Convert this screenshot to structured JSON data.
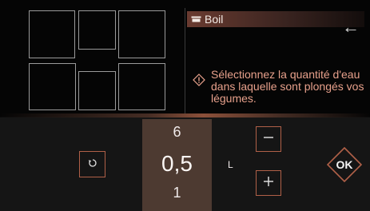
{
  "header": {
    "mode_label": "Boil",
    "mode_icon": "pot-icon"
  },
  "info": {
    "icon": "info-diamond-icon",
    "text": "Sélectionnez la quantité d'eau dans laquelle sont plongés vos légumes."
  },
  "picker": {
    "prev_value": "6",
    "current_value": "0,5",
    "next_value": "1",
    "unit": "L"
  },
  "actions": {
    "ok_label": "OK"
  },
  "colors": {
    "accent": "#b06048",
    "info_text": "#e7a08b",
    "header_bg": "#6a3b30",
    "picker_bg": "#4d3a31"
  }
}
